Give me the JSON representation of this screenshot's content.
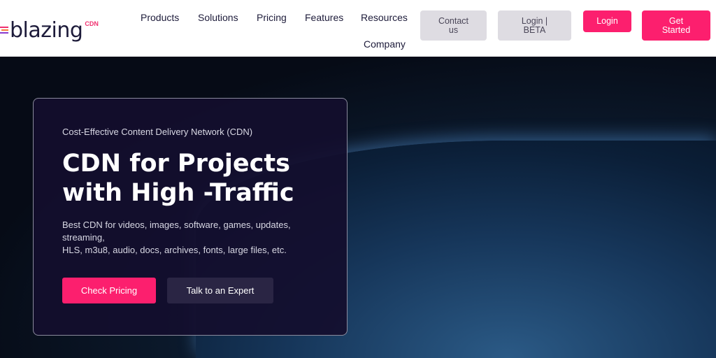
{
  "logo": {
    "word": "blazing",
    "badge": "CDN"
  },
  "nav": [
    "Products",
    "Solutions",
    "Pricing",
    "Features",
    "Resources",
    "Company"
  ],
  "buttons": {
    "contact": "Contact us",
    "login_beta": "Login | BETA",
    "login": "Login",
    "get_started": "Get Started"
  },
  "hero": {
    "subtitle": "Cost-Effective Content Delivery Network (CDN)",
    "title_line1": "CDN for Projects",
    "title_line2": "with High -Traffic",
    "desc_line1": "Best CDN for videos, images, software, games, updates, streaming,",
    "desc_line2": "HLS, m3u8, audio, docs, archives, fonts, large files, etc.",
    "cta_primary": "Check Pricing",
    "cta_secondary": "Talk to an Expert"
  }
}
